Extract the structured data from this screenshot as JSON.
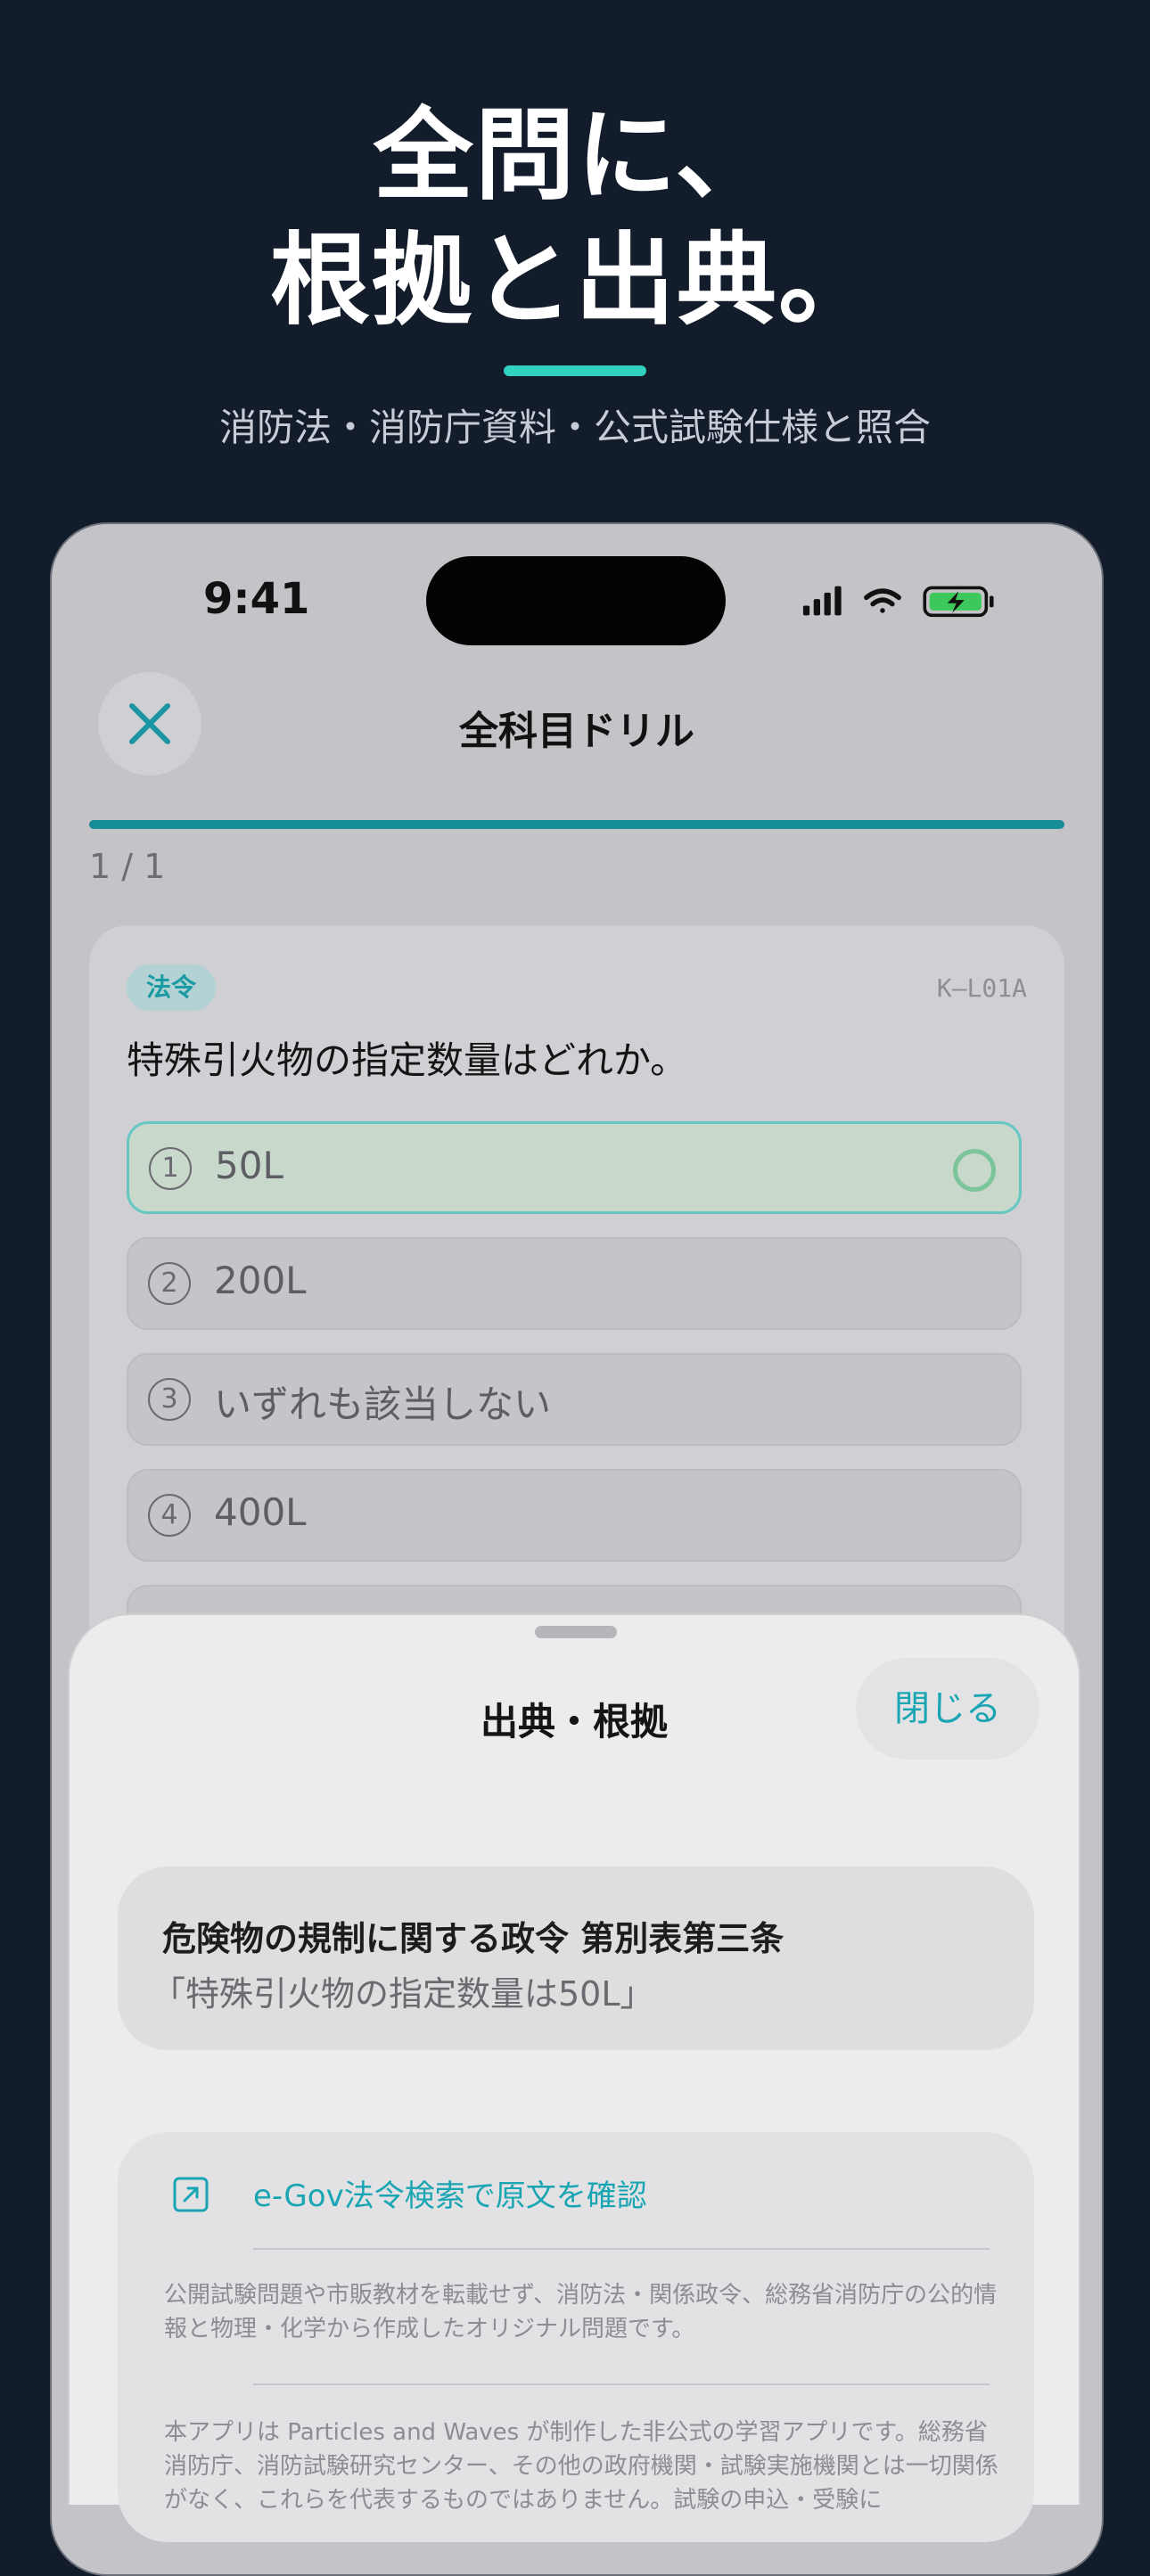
{
  "hero": {
    "title_line1": "全問に、",
    "title_line2": "根拠と出典。",
    "subtitle": "消防法・消防庁資料・公式試験仕様と照合"
  },
  "status_bar": {
    "time": "9:41",
    "icons": [
      "signal-icon",
      "wifi-icon",
      "battery-charging-icon"
    ]
  },
  "nav": {
    "title": "全科目ドリル",
    "close_icon": "close-icon"
  },
  "progress": {
    "label": "1 / 1",
    "fraction": 1.0,
    "color": "#178d98"
  },
  "question": {
    "category": "法令",
    "id": "K–L01A",
    "text": "特殊引火物の指定数量はどれか。",
    "options": [
      {
        "num": "1",
        "label": "50L",
        "correct": true
      },
      {
        "num": "2",
        "label": "200L"
      },
      {
        "num": "3",
        "label": "いずれも該当しない"
      },
      {
        "num": "4",
        "label": "400L"
      }
    ]
  },
  "sheet": {
    "title": "出典・根拠",
    "close_label": "閉じる",
    "citation": {
      "law": "危険物の規制に関する政令 第別表第三条",
      "quote": "「特殊引火物の指定数量は50L」"
    },
    "link_label": "e-Gov法令検索で原文を確認",
    "note1": "公開試験問題や市販教材を転載せず、消防法・関係政令、総務省消防庁の公的情報と物理・化学から作成したオリジナル問題です。",
    "note2": "本アプリは Particles and Waves が制作した非公式の学習アプリです。総務省消防庁、消防試験研究センター、その他の政府機関・試験実施機関とは一切関係がなく、これらを代表するものではありません。試験の申込・受験に"
  },
  "colors": {
    "background": "#131c2b",
    "accent": "#2fd3bf",
    "link": "#1aa5b3"
  }
}
